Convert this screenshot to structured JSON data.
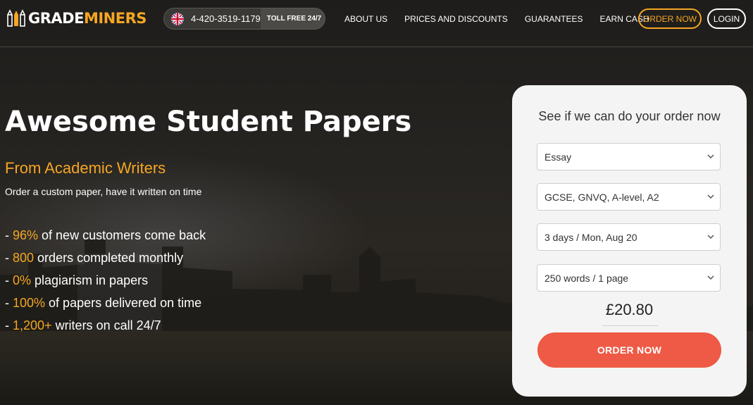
{
  "brand": {
    "name_part1": "GRADE",
    "name_part2": "MINERS"
  },
  "header": {
    "phone_number": "4-420-3519-1179",
    "tollfree_label": "TOLL FREE 24/7",
    "nav": [
      "ABOUT US",
      "PRICES AND DISCOUNTS",
      "GUARANTEES",
      "EARN CASH"
    ],
    "order_label": "ORDER NOW",
    "login_label": "LOGIN"
  },
  "hero": {
    "title": "Awesome Student Papers",
    "subtitle": "From Academic Writers",
    "description": "Order a custom paper, have it written on time",
    "stats": [
      {
        "prefix": "- ",
        "value": "96%",
        "text": " of new customers come back"
      },
      {
        "prefix": "- ",
        "value": "800",
        "text": " orders completed monthly"
      },
      {
        "prefix": "- ",
        "value": "0%",
        "text": " plagiarism in papers"
      },
      {
        "prefix": "- ",
        "value": "100%",
        "text": " of papers delivered on time"
      },
      {
        "prefix": "- ",
        "value": "1,200+",
        "text": " writers on call 24/7"
      }
    ]
  },
  "order_form": {
    "title": "See if we can do your order now",
    "paper_type": "Essay",
    "academic_level": "GCSE, GNVQ, A-level, A2",
    "deadline": "3 days / Mon, Aug 20",
    "pages": "250 words / 1 page",
    "price": "£20.80",
    "submit_label": "ORDER NOW"
  },
  "colors": {
    "accent": "#f5a623",
    "cta": "#ee5a45",
    "card_bg": "#f4f4f4"
  },
  "icons": [
    "logo-pencils-icon",
    "uk-flag-icon",
    "chevron-down-icon"
  ]
}
